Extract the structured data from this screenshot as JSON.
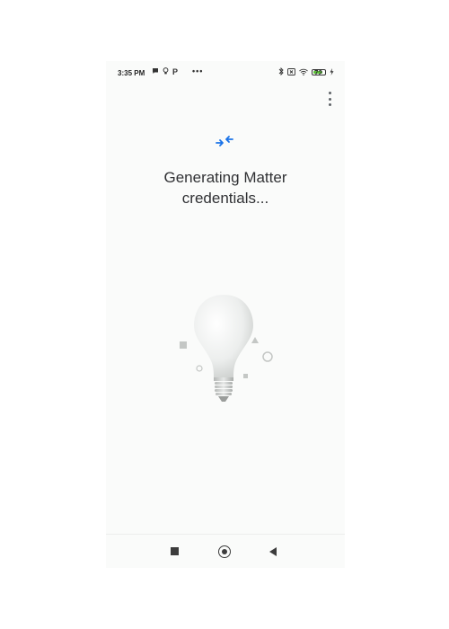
{
  "status_bar": {
    "time": "3:35 PM",
    "left_icons": [
      "chat-bubble-icon",
      "lightbulb-icon",
      "p-icon"
    ],
    "more_label": "•••",
    "right_icons": [
      "bluetooth-icon",
      "sim-x-icon",
      "wifi-icon",
      "battery-icon",
      "charging-bolt-icon"
    ],
    "battery_level": "72",
    "battery_color": "#5bc236"
  },
  "header": {
    "menu_icon": "overflow-menu-icon"
  },
  "main": {
    "status_icon": "sync-arrows-icon",
    "status_icon_color": "#1a73e8",
    "title": "Generating Matter credentials...",
    "illustration": "lightbulb-illustration"
  },
  "nav_bar": {
    "recents_icon": "square-icon",
    "home_icon": "circle-home-icon",
    "back_icon": "triangle-back-icon"
  }
}
